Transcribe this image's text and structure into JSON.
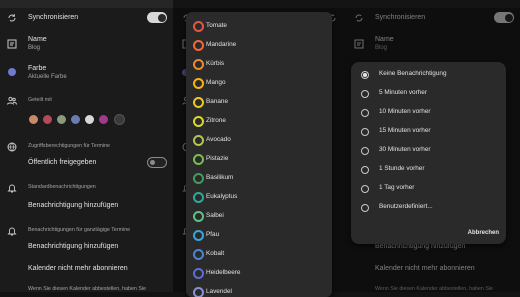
{
  "settings": {
    "sync_label": "Synchronisieren",
    "name_label": "Name",
    "name_value": "Blog",
    "color_label": "Farbe",
    "color_value": "Aktuelle Farbe",
    "shared_label": "Geteilt mit",
    "access_label": "Zugriffsberechtigungen für Termine",
    "public_label": "Öffentlich freigegeben",
    "default_notif_label": "Standardbenachrichtigungen",
    "add_notif_label": "Benachrichtigung hinzufügen",
    "allday_notif_label": "Benachrichtigungen für ganztägige Termine",
    "add_notif_label_2": "Benachrichtigung hinzufügen",
    "unsubscribe_label": "Kalender nicht mehr abonnieren",
    "footer_text": "Wenn Sie diesen Kalender abbestellen, haben Sie"
  },
  "colors": [
    {
      "label": "Tomate",
      "color": "#e8553e"
    },
    {
      "label": "Mandarine",
      "color": "#f06a3a"
    },
    {
      "label": "Kürbis",
      "color": "#f28a24"
    },
    {
      "label": "Mango",
      "color": "#f3b31c"
    },
    {
      "label": "Banane",
      "color": "#f0c81c"
    },
    {
      "label": "Zitrone",
      "color": "#d8d830"
    },
    {
      "label": "Avocado",
      "color": "#b0c84a"
    },
    {
      "label": "Pistazie",
      "color": "#7cba58"
    },
    {
      "label": "Basilikum",
      "color": "#3f9e5a"
    },
    {
      "label": "Eukalyptus",
      "color": "#34a795"
    },
    {
      "label": "Salbei",
      "color": "#5dc089"
    },
    {
      "label": "Pfau",
      "color": "#3ba6d6"
    },
    {
      "label": "Kobalt",
      "color": "#4a86d8"
    },
    {
      "label": "Heidelbeere",
      "color": "#5b6fd0"
    },
    {
      "label": "Lavendel",
      "color": "#8e8ed8"
    }
  ],
  "notif_options": [
    {
      "label": "Keine Benachrichtigung",
      "selected": true
    },
    {
      "label": "5 Minuten vorher",
      "selected": false
    },
    {
      "label": "10 Minuten vorher",
      "selected": false
    },
    {
      "label": "15 Minuten vorher",
      "selected": false
    },
    {
      "label": "30 Minuten vorher",
      "selected": false
    },
    {
      "label": "1 Stunde vorher",
      "selected": false
    },
    {
      "label": "1 Tag vorher",
      "selected": false
    },
    {
      "label": "Benutzerdefiniert...",
      "selected": false
    }
  ],
  "dialog_cancel": "Abbrechen",
  "accent_colors": {
    "current_color": "#6f7ad0"
  }
}
